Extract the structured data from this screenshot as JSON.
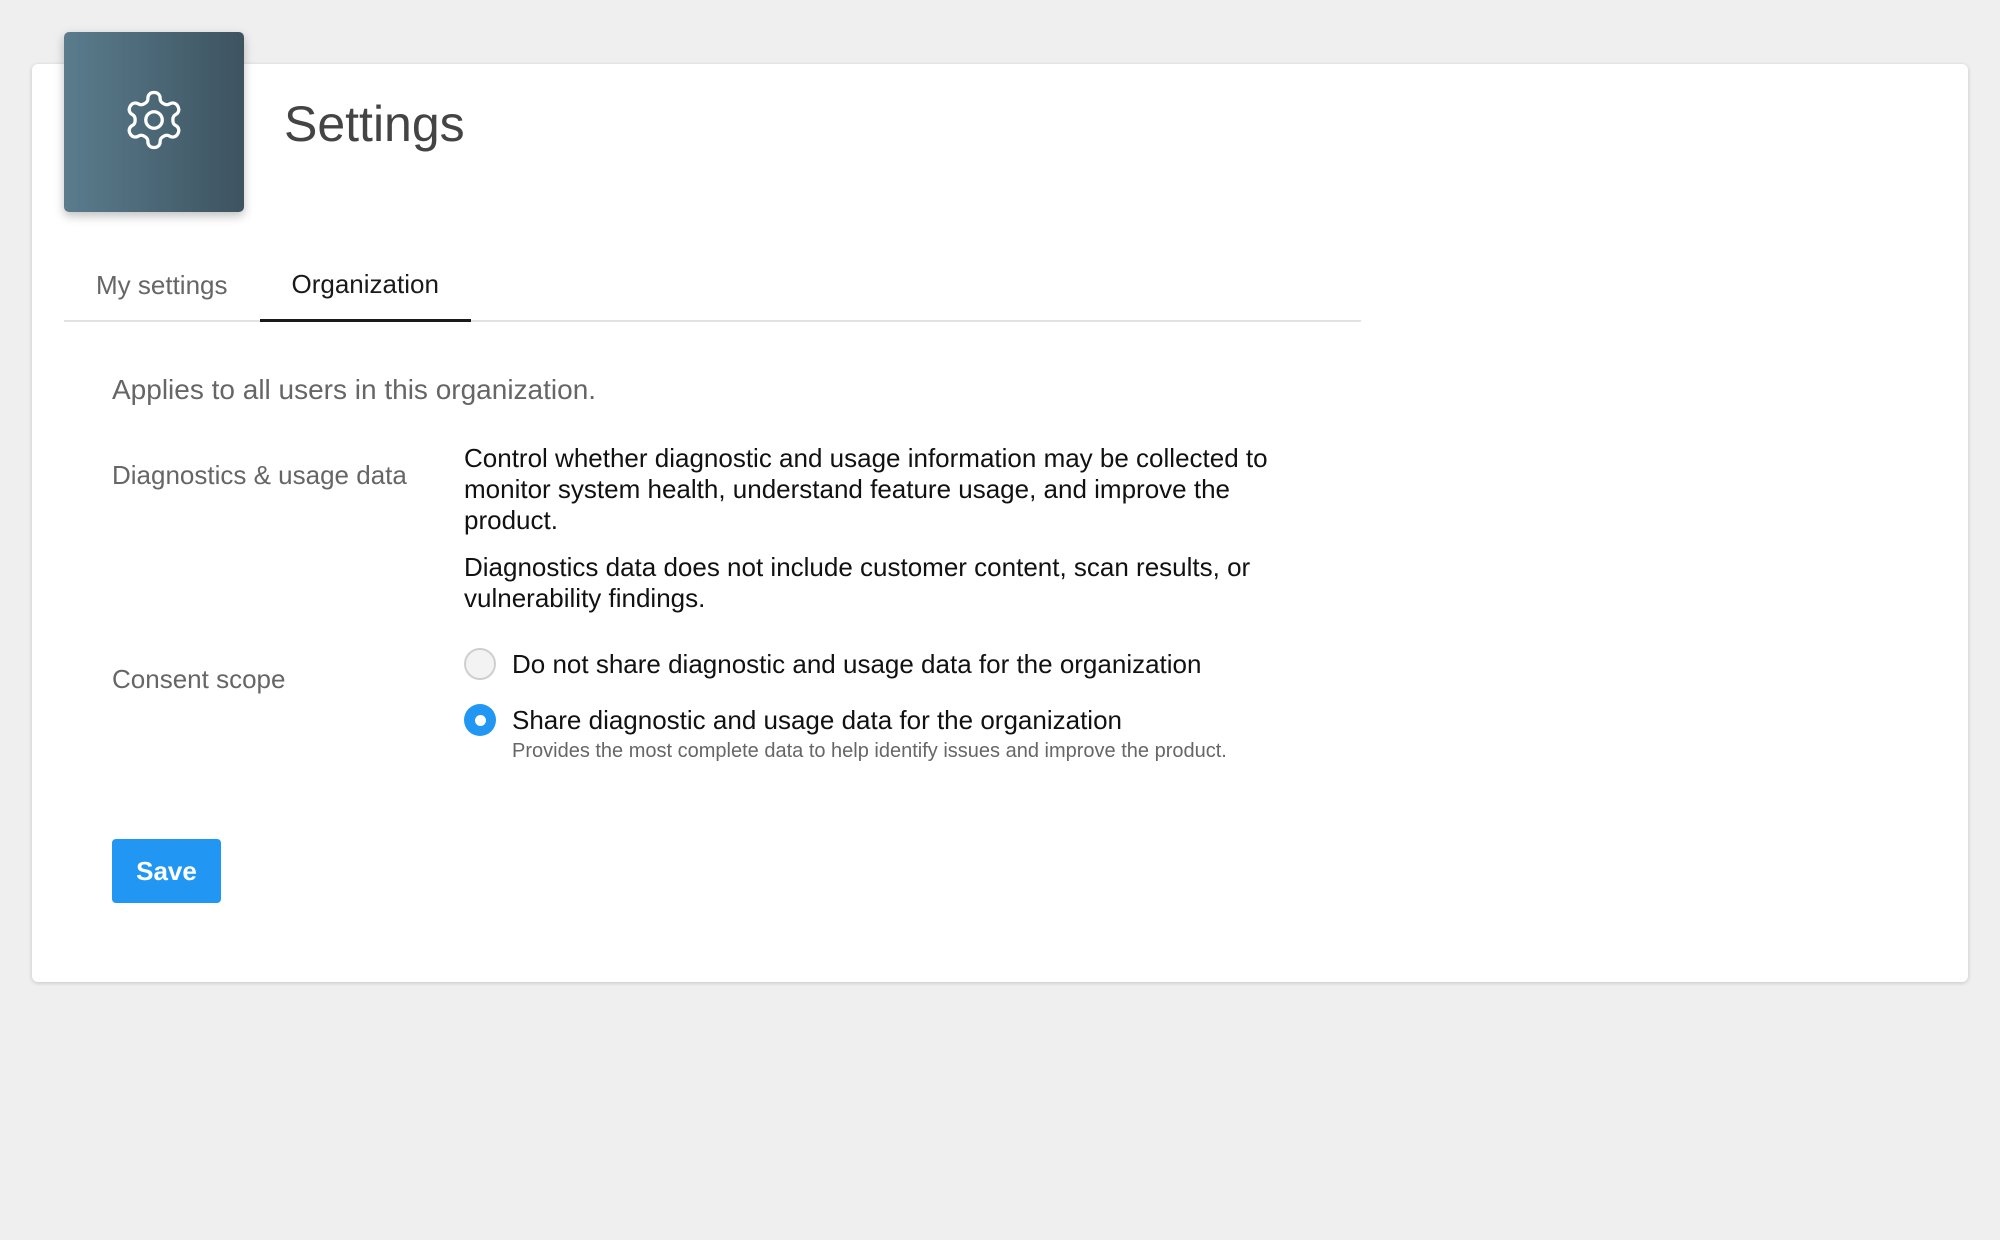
{
  "header": {
    "app_icon": "gear-icon",
    "title": "Settings"
  },
  "tabs": [
    {
      "label": "My settings",
      "active": false
    },
    {
      "label": "Organization",
      "active": true
    }
  ],
  "organization": {
    "intro": "Applies to all users in this organization.",
    "diagnostics": {
      "label": "Diagnostics & usage data",
      "description_1": "Control whether diagnostic and usage information may be collected to monitor system health, understand feature usage, and improve the product.",
      "description_2": "Diagnostics data does not include customer content, scan results, or vulnerability findings."
    },
    "consent": {
      "label": "Consent scope",
      "options": [
        {
          "label": "Do not share diagnostic and usage data for the organization",
          "help": "",
          "selected": false
        },
        {
          "label": "Share diagnostic and usage data for the organization",
          "help": "Provides the most complete data to help identify issues and improve the product.",
          "selected": true
        }
      ]
    },
    "save_label": "Save"
  },
  "colors": {
    "accent": "#2196f3",
    "tile_gradient_start": "#5a7c8d",
    "tile_gradient_end": "#3d5360",
    "background": "#efefef"
  }
}
